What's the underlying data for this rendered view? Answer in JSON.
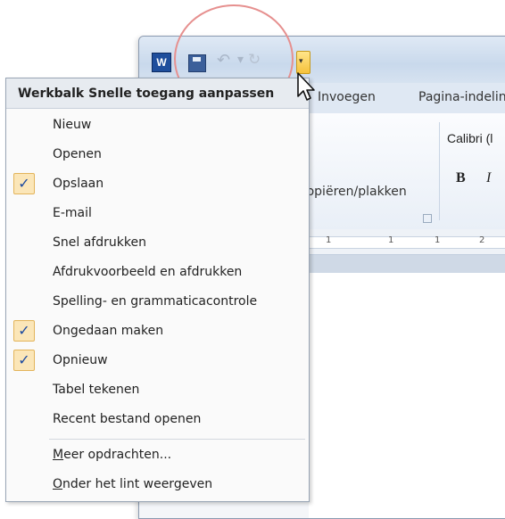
{
  "window": {
    "word_icon": "W",
    "tabs": [
      "Invoegen",
      "Pagina-indeling"
    ],
    "font_name": "Calibri (l",
    "clipboard_label": "kopiëren/plakken",
    "bold_label": "B",
    "italic_label": "I",
    "ruler_numbers": [
      "1",
      "1",
      "1",
      "2"
    ]
  },
  "menu": {
    "title": "Werkbalk Snelle toegang aanpassen",
    "items": [
      {
        "label": "Nieuw",
        "checked": false
      },
      {
        "label": "Openen",
        "checked": false
      },
      {
        "label": "Opslaan",
        "checked": true
      },
      {
        "label": "E-mail",
        "checked": false
      },
      {
        "label": "Snel afdrukken",
        "checked": false
      },
      {
        "label": "Afdrukvoorbeeld en afdrukken",
        "checked": false
      },
      {
        "label": "Spelling- en grammaticacontrole",
        "checked": false
      },
      {
        "label": "Ongedaan maken",
        "checked": true
      },
      {
        "label": "Opnieuw",
        "checked": true
      },
      {
        "label": "Tabel tekenen",
        "checked": false
      },
      {
        "label": "Recent bestand openen",
        "checked": false
      }
    ],
    "more_commands": {
      "access_key": "M",
      "rest": "eer opdrachten..."
    },
    "show_below": {
      "access_key": "O",
      "rest": "nder het lint weergeven"
    }
  },
  "colors": {
    "highlight_circle": "#e6908f",
    "check_bg": "#fbe6b8",
    "dropdown_button": "#f6c23c"
  }
}
